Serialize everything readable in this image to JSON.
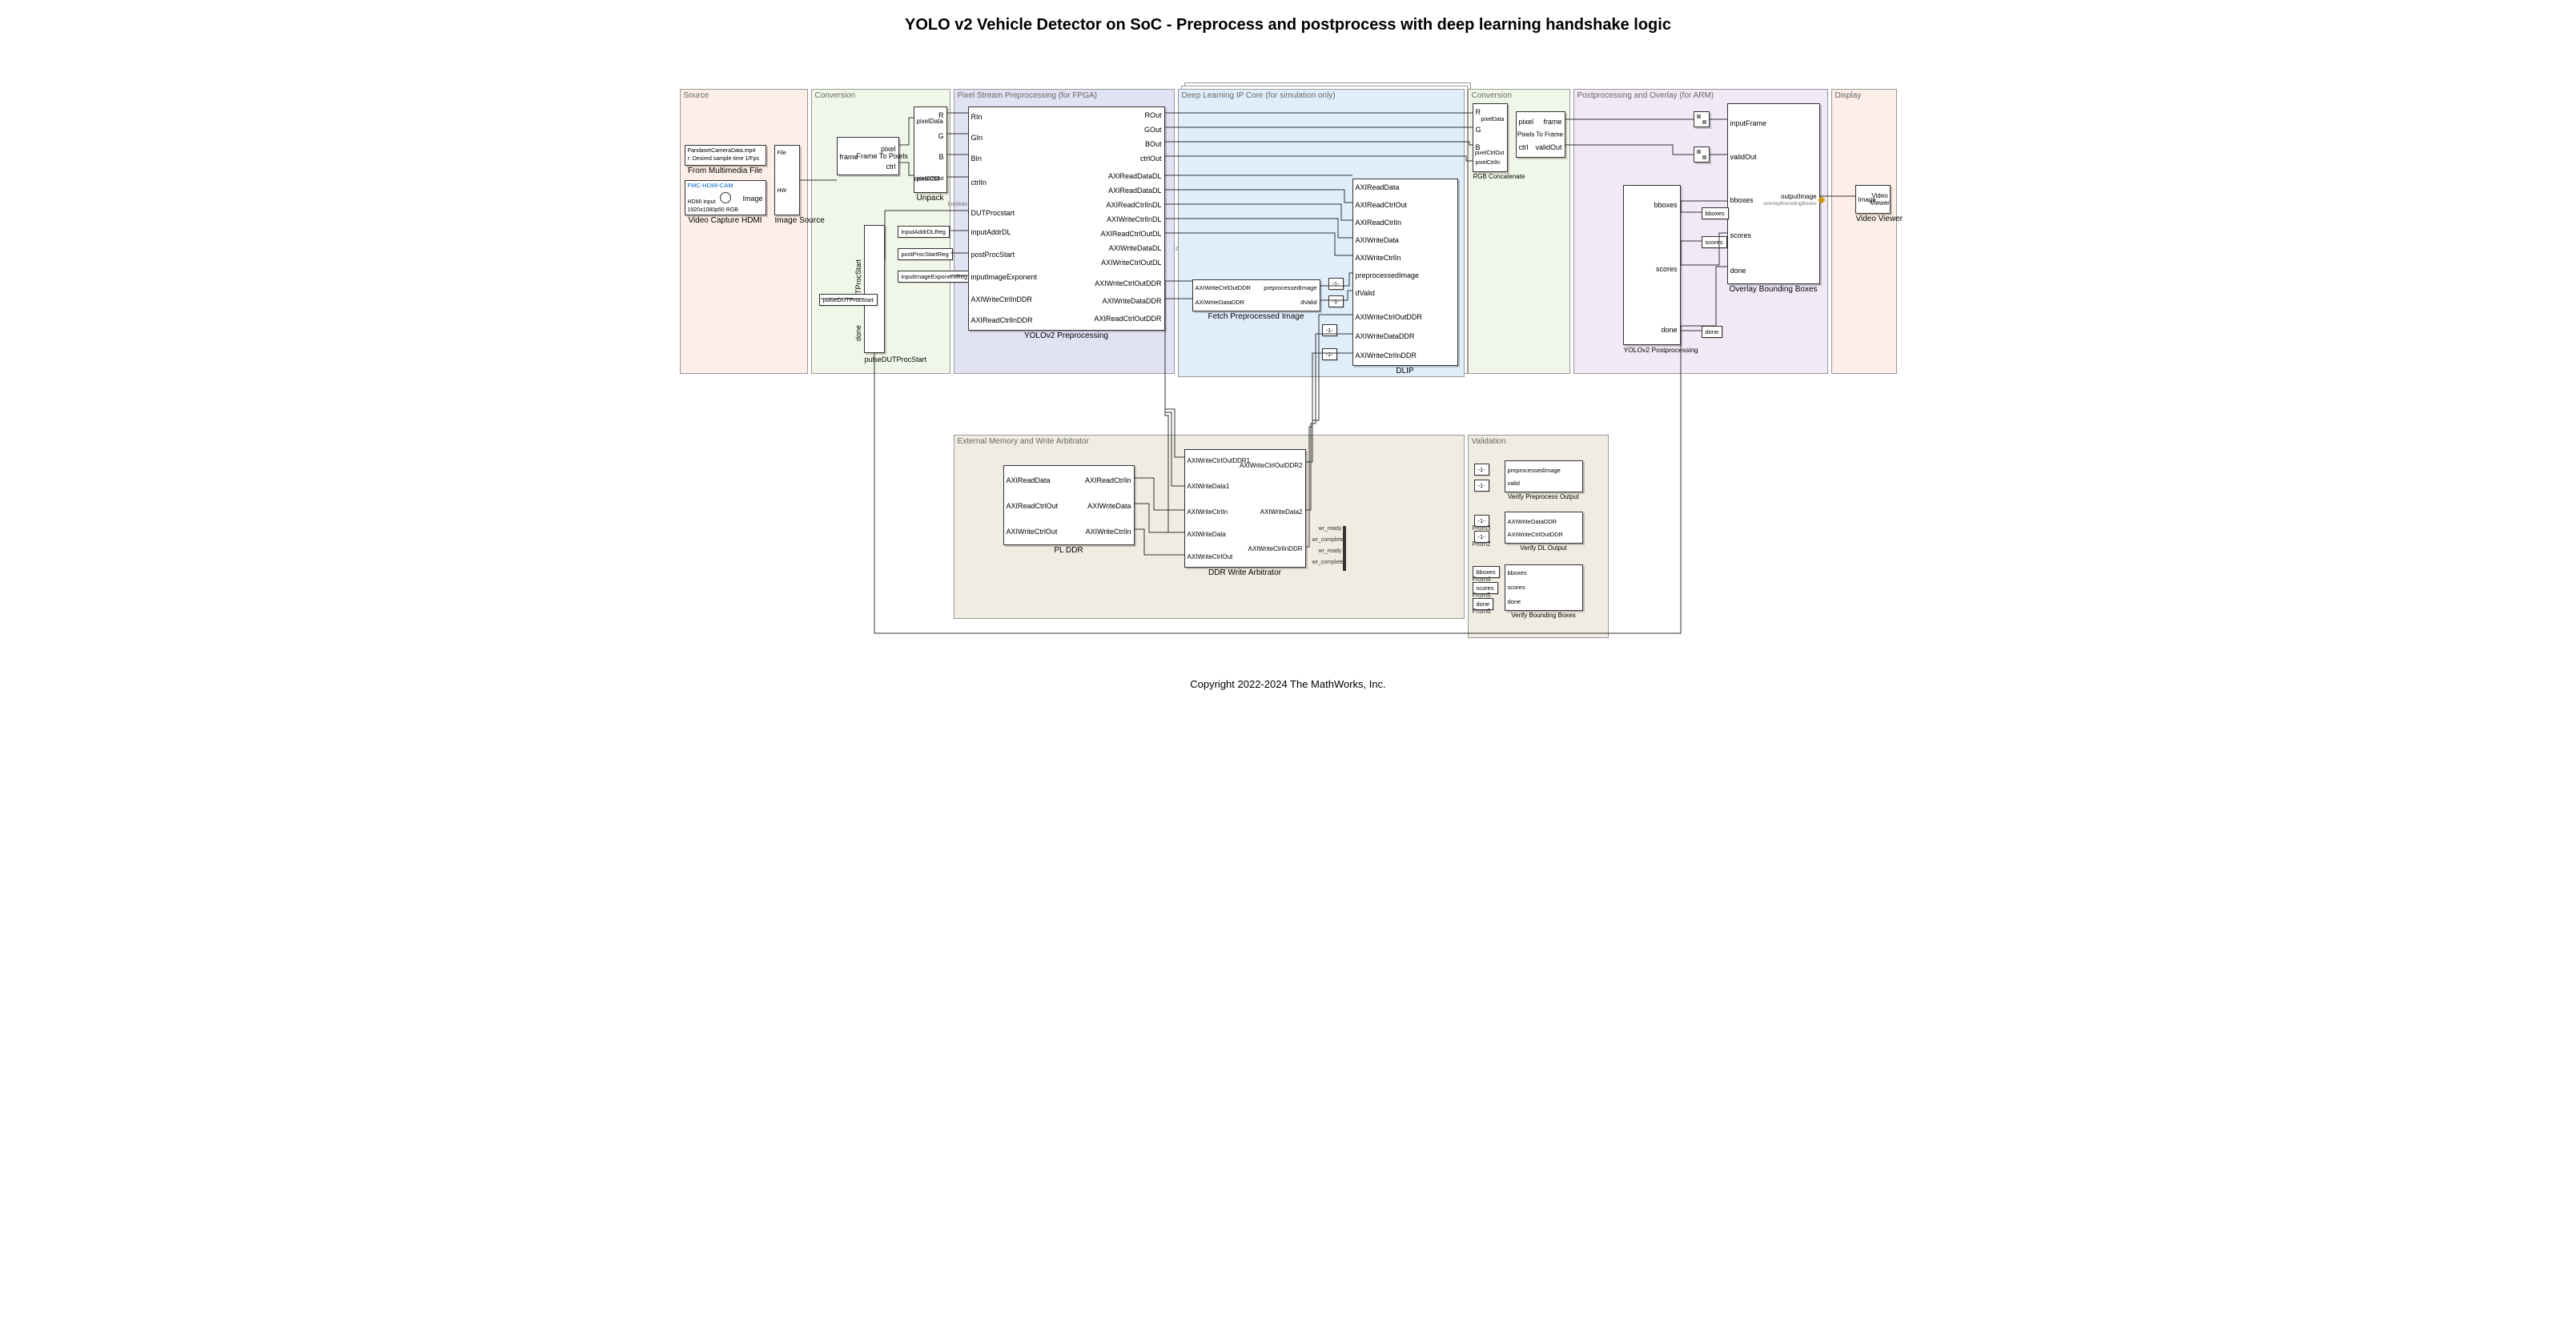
{
  "title": "YOLO v2 Vehicle Detector on SoC - Preprocess and postprocess with deep learning handshake logic",
  "copyright": "Copyright 2022-2024 The MathWorks, Inc.",
  "areas": {
    "source": {
      "label": "Source",
      "fill": "#fdeee7"
    },
    "conv1": {
      "label": "Conversion",
      "fill": "#f1f7e8"
    },
    "fpga": {
      "label": "Pixel Stream Preprocessing (for FPGA)",
      "fill": "#e2e2f5"
    },
    "dlip": {
      "label": "Deep Learning IP Core (for simulation only)",
      "fill": "#e0eefb"
    },
    "conv2": {
      "label": "Conversion",
      "fill": "#f1f7e8"
    },
    "post": {
      "label": "Postprocessing and Overlay (for ARM)",
      "fill": "#f2e9f7"
    },
    "display": {
      "label": "Display",
      "fill": "#fdeee7"
    },
    "extmem": {
      "label": "External Memory and Write Arbitrator",
      "fill": "#f0ece2"
    },
    "valid": {
      "label": "Validation",
      "fill": "#f0ece2"
    }
  },
  "src": {
    "mmfile": {
      "l1": "PandasetCameraData.mp4",
      "l2": "r: Desired sample time 1/Fps",
      "name": "From Multimedia File",
      "out": "File"
    },
    "hdmi": {
      "link": "FMC-HDMI-CAM",
      "l1": "HDMI input",
      "l2": "1920x1080p50 RGB",
      "name": "Video Capture HDMI",
      "out": "Image"
    },
    "switch": {
      "name": "Image Source",
      "p1": "HW"
    }
  },
  "conv1_blocks": {
    "ftp": {
      "in": "frame",
      "name": "Frame To Pixels",
      "o1": "pixel",
      "o2": "ctrl"
    },
    "unpack": {
      "name": "Unpack",
      "iTop": "pixelData",
      "iBot": "pixelCtrl",
      "o": [
        "R",
        "G",
        "B",
        "pixelCtrlOut"
      ]
    },
    "dutps": {
      "name": "pulseDUTProcStart",
      "sideTop": "DUTProcStart",
      "sideBot": "done"
    },
    "tags": [
      "inputAddrDLReg",
      "postProcStartReg",
      "inputImageExponentReg"
    ],
    "tagOut": "pulseDUTProcstart"
  },
  "preproc": {
    "name": "YOLOv2  Preprocessing",
    "inputs": [
      "RIn",
      "GIn",
      "BIn",
      "ctrlIn",
      "DUTProcstart",
      "inputAddrDL",
      "postProcStart",
      "inputImageExponent",
      "AXIWriteCtrlInDDR",
      "AXIReadCtrlInDDR"
    ],
    "sideNote": "boolean",
    "outputs": [
      "ROut",
      "GOut",
      "BOut",
      "ctrlOut",
      "AXIReadDataDL",
      "AXIReadDataDL",
      "AXIReadCtrlInDL",
      "AXIWriteCtrlInDL",
      "AXIReadCtrlOutDL",
      "AXIWriteDataDL",
      "AXIWriteCtrlOutDL",
      "AXIWriteCtrlOutDDR",
      "AXIWriteDataDDR",
      "AXIReadCtrlOutDDR"
    ],
    "sideNote2": "2"
  },
  "fetch": {
    "name": "Fetch Preprocessed Image",
    "i1": "AXIWriteCtrlOutDDR",
    "i2": "AXIWriteDataDDR",
    "o1": "preprocessedImage",
    "o2": "dValid"
  },
  "dlip": {
    "name": "DLIP",
    "inputs": [
      "AXIReadData",
      "AXIReadCtrlOut",
      "AXIReadCtrlIn",
      "AXIWriteData",
      "AXIWriteCtrlIn",
      "preprocessedImage",
      "dValid",
      "AXIWriteCtrlOutDDR",
      "AXIWriteDataDDR",
      "AXIWriteCtrlInDDR"
    ]
  },
  "conv2": {
    "rgbcat": {
      "name": "RGB Concatenate",
      "ins": [
        "R",
        "G",
        "B",
        "pixelCtrlIn"
      ],
      "outs": [
        "pixelData",
        "pixelCtrlOut"
      ]
    },
    "ptf": {
      "name": "Pixels To Frame",
      "ins": [
        "pixel",
        "ctrl"
      ],
      "outs": [
        "frame",
        "validOut"
      ]
    }
  },
  "post_blocks": {
    "rc1": "inputFrame",
    "rc2": "validOut",
    "postproc": {
      "name": "YOLOv2 Postprocessing",
      "outs": [
        "bboxes",
        "scores",
        "done"
      ]
    },
    "ovl": {
      "name": "Overlay Bounding Boxes",
      "ins": [
        "bboxes",
        "scores",
        "done"
      ],
      "outLabel": "outputImage",
      "sub": "overlayBoundingBoxes"
    },
    "tags": [
      "bboxes",
      "scores",
      "done"
    ]
  },
  "display": {
    "name": "Video Viewer",
    "port": "Image",
    "text": "Video\nViewer"
  },
  "extmem_blocks": {
    "plddr": {
      "name": "PL DDR",
      "l": [
        "AXIReadData",
        "AXIReadCtrlOut",
        "AXIWriteCtrlOut"
      ],
      "r": [
        "AXIReadCtrlIn",
        "AXIWriteData",
        "AXIWriteCtrlIn"
      ]
    },
    "arb": {
      "name": "DDR Write Arbitrator",
      "l": [
        "AXIWriteCtrlOutDDR1",
        "AXIWriteData1",
        "AXIWriteCtrlIn",
        "AXIWriteData",
        "AXIWriteCtrlOut"
      ],
      "r": [
        "AXIWriteCtrlOutDDR2",
        "AXIWriteData2",
        "AXIWriteCtrlInDDR"
      ]
    },
    "term": [
      "wr_ready",
      "wr_complete",
      "wr_ready",
      "wr_complete"
    ]
  },
  "valid_blocks": {
    "vpre": {
      "name": "Verify Preprocess Output",
      "ins": [
        "preprocessedImage",
        "valid"
      ]
    },
    "vdl": {
      "name": "Verify DL Output",
      "ins": [
        "AXIWriteDataDDR",
        "AXIWriteCtrlOutDDR"
      ]
    },
    "vbb": {
      "name": "Verify Bounding Boxes",
      "ins": [
        "bboxes",
        "scores",
        "done"
      ]
    },
    "fromTags": [
      "-1-",
      "-1-",
      "-1-",
      "-1-",
      "bboxes",
      "scores",
      "done"
    ],
    "fromLbls": [
      "",
      "",
      "From3",
      "From2",
      "From4",
      "From5",
      "From6"
    ]
  }
}
